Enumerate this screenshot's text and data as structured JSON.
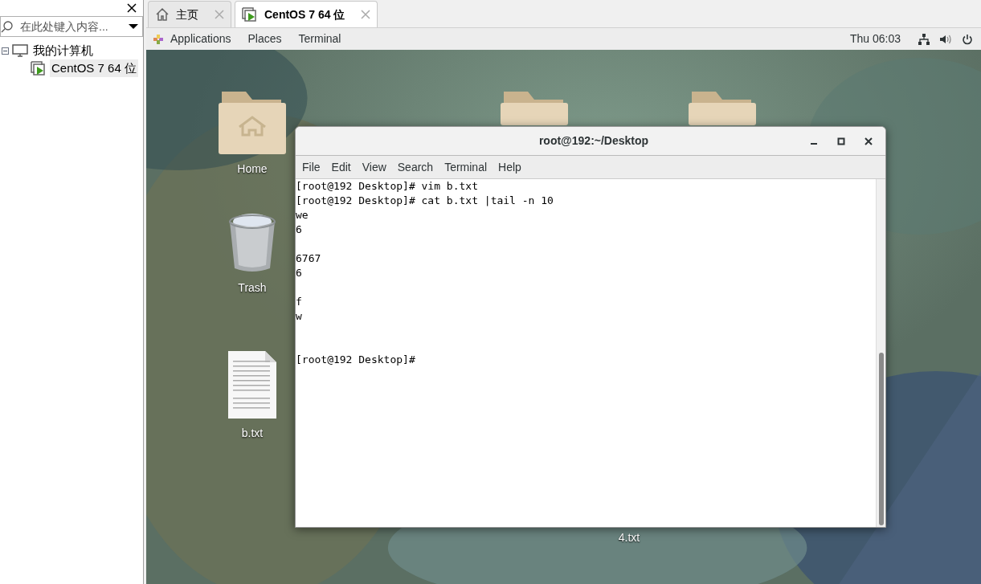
{
  "library": {
    "search": {
      "placeholder": "在此处键入内容..."
    },
    "tree": [
      {
        "label": "我的计算机",
        "expanded": true,
        "selected": false,
        "children": [
          {
            "label": "CentOS 7 64 位",
            "selected": true
          }
        ]
      }
    ]
  },
  "tabs": [
    {
      "label": "主页",
      "kind": "home",
      "selected": false
    },
    {
      "label": "CentOS 7 64 位",
      "kind": "vm",
      "selected": true
    }
  ],
  "top_bar": {
    "menus": [
      "Applications",
      "Places",
      "Terminal"
    ],
    "clock": "Thu 06:03"
  },
  "desktop_icons": [
    {
      "kind": "home-folder",
      "label": "Home"
    },
    {
      "kind": "trash",
      "label": "Trash"
    },
    {
      "kind": "text-file",
      "label": "b.txt"
    },
    {
      "kind": "folder"
    },
    {
      "kind": "folder"
    },
    {
      "kind": "hidden-label",
      "label": "4.txt"
    }
  ],
  "terminal": {
    "title": "root@192:~/Desktop",
    "menus": [
      "File",
      "Edit",
      "View",
      "Search",
      "Terminal",
      "Help"
    ],
    "output": "[root@192 Desktop]# vim b.txt\n[root@192 Desktop]# cat b.txt |tail -n 10\nwe\n6\n\n6767\n6\n\nf\nw\n\n\n[root@192 Desktop]#"
  }
}
